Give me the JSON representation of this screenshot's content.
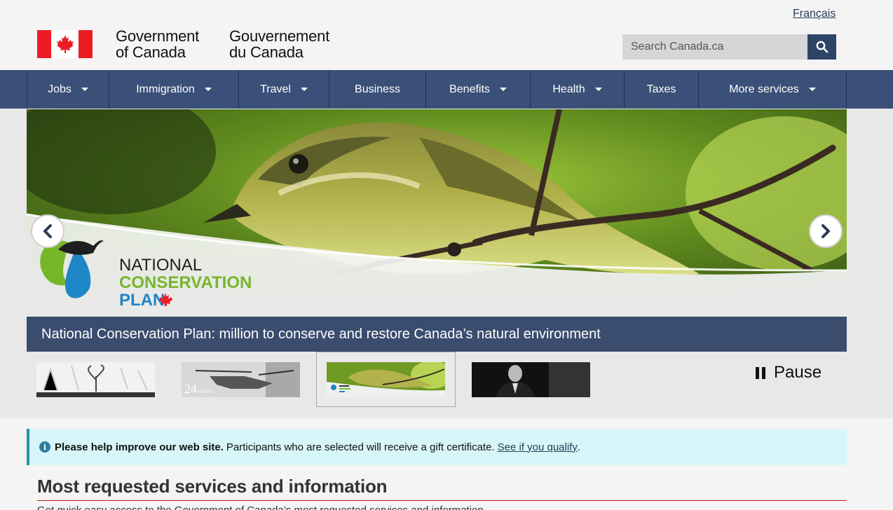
{
  "header": {
    "lang_link": "Français",
    "wordmark_en_line1": "Government",
    "wordmark_en_line2": "of Canada",
    "wordmark_fr_line1": "Gouvernement",
    "wordmark_fr_line2": "du Canada",
    "search_placeholder": "Search Canada.ca",
    "search_icon": "magnifier-icon"
  },
  "nav": {
    "items": [
      {
        "label": "Jobs",
        "dropdown": true
      },
      {
        "label": "Immigration",
        "dropdown": true
      },
      {
        "label": "Travel",
        "dropdown": true
      },
      {
        "label": "Business",
        "dropdown": false
      },
      {
        "label": "Benefits",
        "dropdown": true
      },
      {
        "label": "Health",
        "dropdown": true
      },
      {
        "label": "Taxes",
        "dropdown": false
      },
      {
        "label": "More services",
        "dropdown": true
      }
    ]
  },
  "carousel": {
    "caption": "National Conservation Plan: million to conserve and restore Canada’s natural environment",
    "logo_line1": "NATIONAL",
    "logo_line2": "CONSERVATION",
    "logo_line3": "PLAN",
    "pause_label": "Pause",
    "thumb2_label": "24",
    "thumb2_sublabel": "SEVEN"
  },
  "alert": {
    "bold": "Please help improve our web site.",
    "text": "Participants who are selected will receive a gift certificate.",
    "link": "See if you qualify",
    "end": "."
  },
  "section": {
    "title": "Most requested services and information",
    "sub": "Get quick easy access to the Government of Canada’s most requested services and information"
  },
  "colors": {
    "nav_bg": "#3a5078",
    "flag_red": "#ed1c24",
    "alert_bg": "#d7f6fa",
    "caption_bg": "#3a4d6e"
  }
}
